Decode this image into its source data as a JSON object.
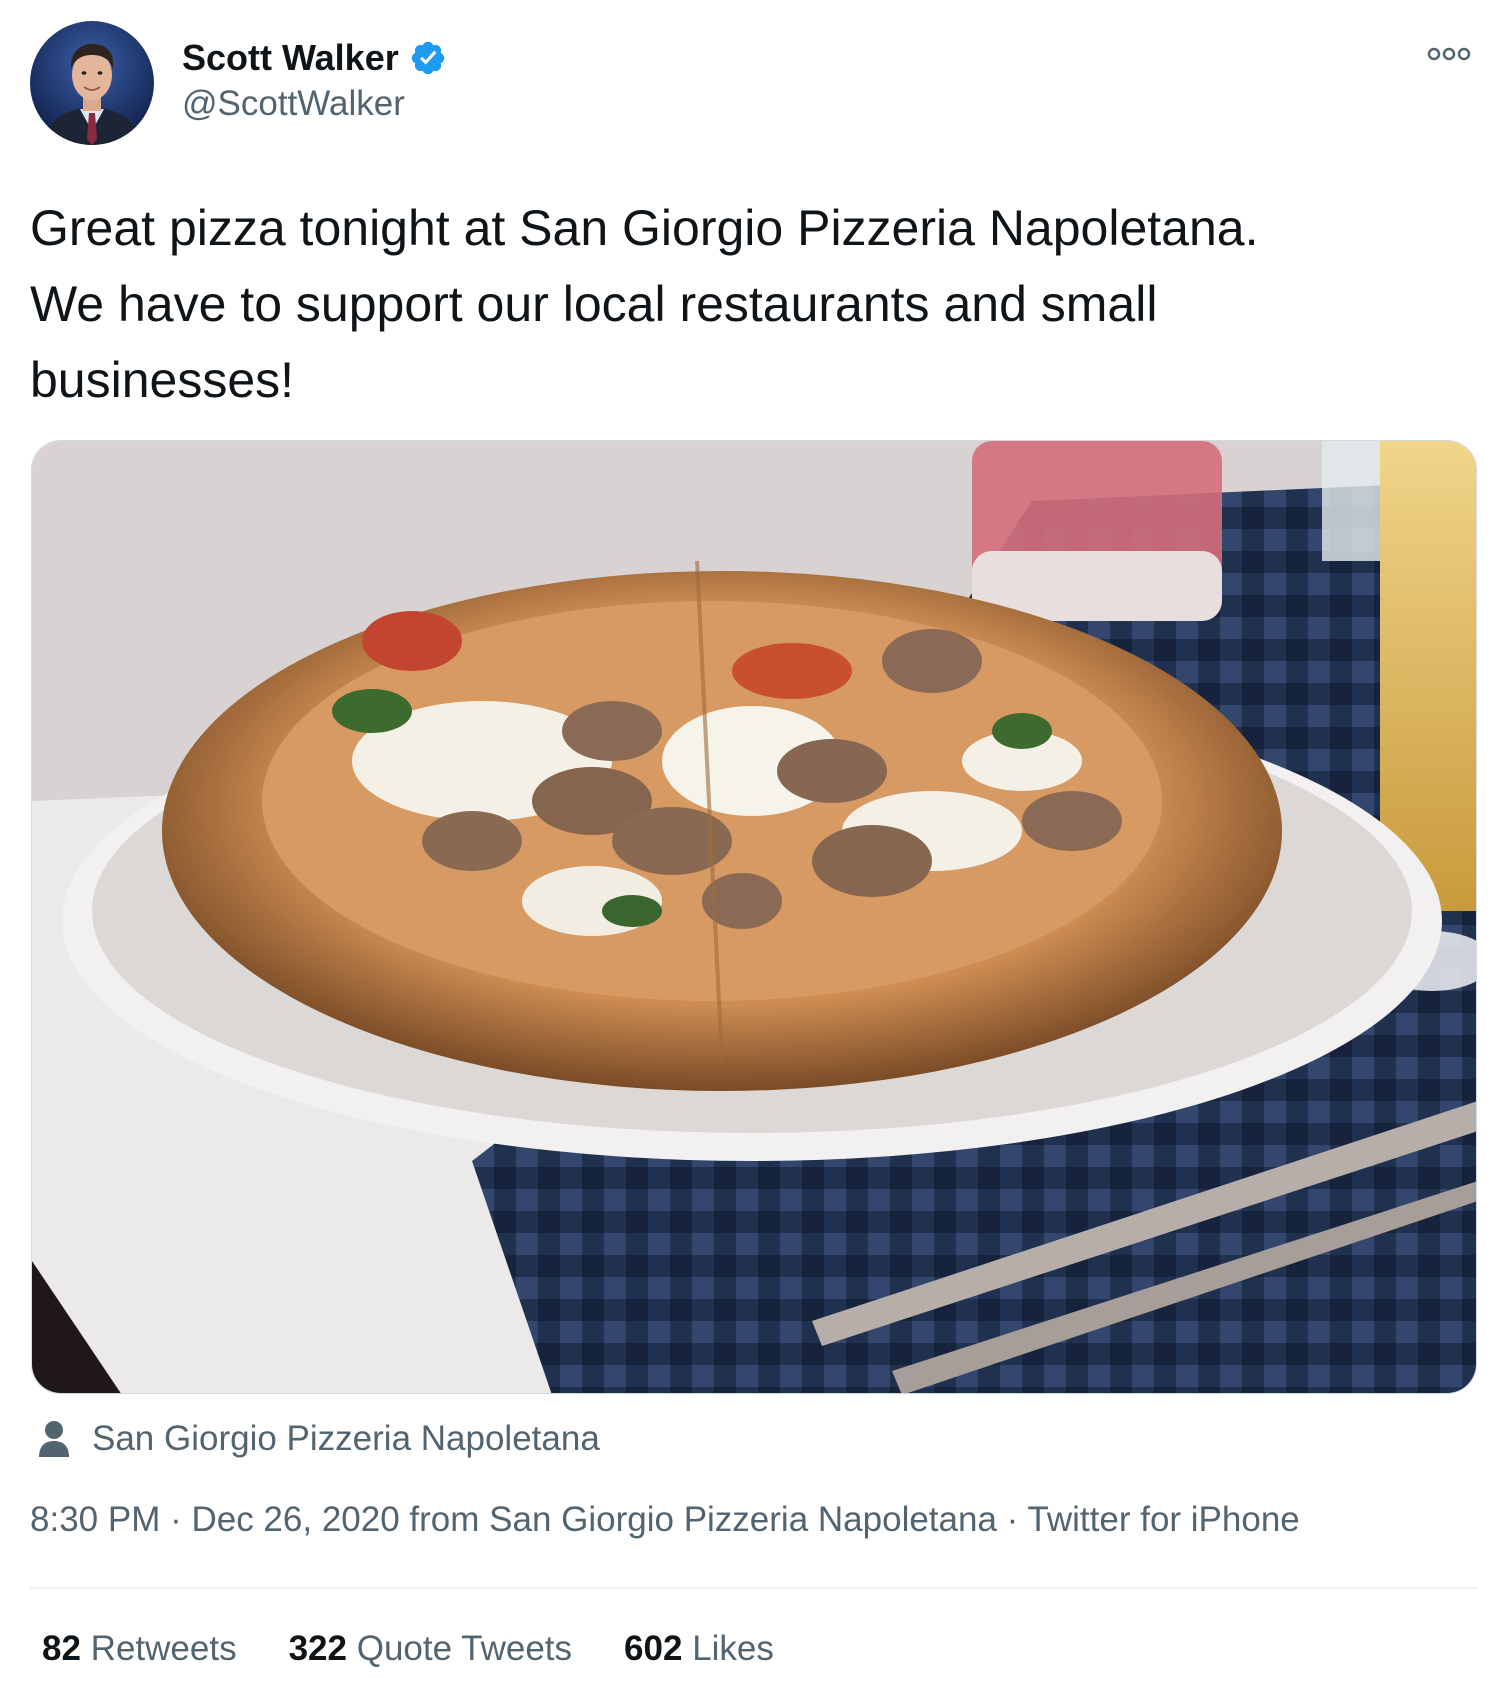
{
  "author": {
    "display_name": "Scott Walker",
    "handle": "@ScottWalker",
    "verified": true
  },
  "tweet": {
    "text": "Great pizza tonight at San Giorgio Pizzeria Napoletana.\nWe have to support our local restaurants and small\nbusinesses!"
  },
  "media": {
    "tagged_user": "San Giorgio Pizzeria Napoletana"
  },
  "meta": {
    "time": "8:30 PM",
    "separator_1": " · ",
    "date": "Dec 26, 2020",
    "from_word": " from ",
    "location": "San Giorgio Pizzeria Napoletana",
    "separator_2": " · ",
    "source": "Twitter for iPhone"
  },
  "stats": {
    "retweets": {
      "count": "82",
      "label": "Retweets"
    },
    "quote_tweets": {
      "count": "322",
      "label": "Quote Tweets"
    },
    "likes": {
      "count": "602",
      "label": "Likes"
    }
  },
  "colors": {
    "text_primary": "#0f1419",
    "text_secondary": "#536471",
    "verified_blue": "#1d9bf0",
    "divider": "#eff3f4"
  },
  "icons": {
    "verified": "verified-badge-icon",
    "more": "more-options-icon",
    "tag": "person-icon"
  }
}
